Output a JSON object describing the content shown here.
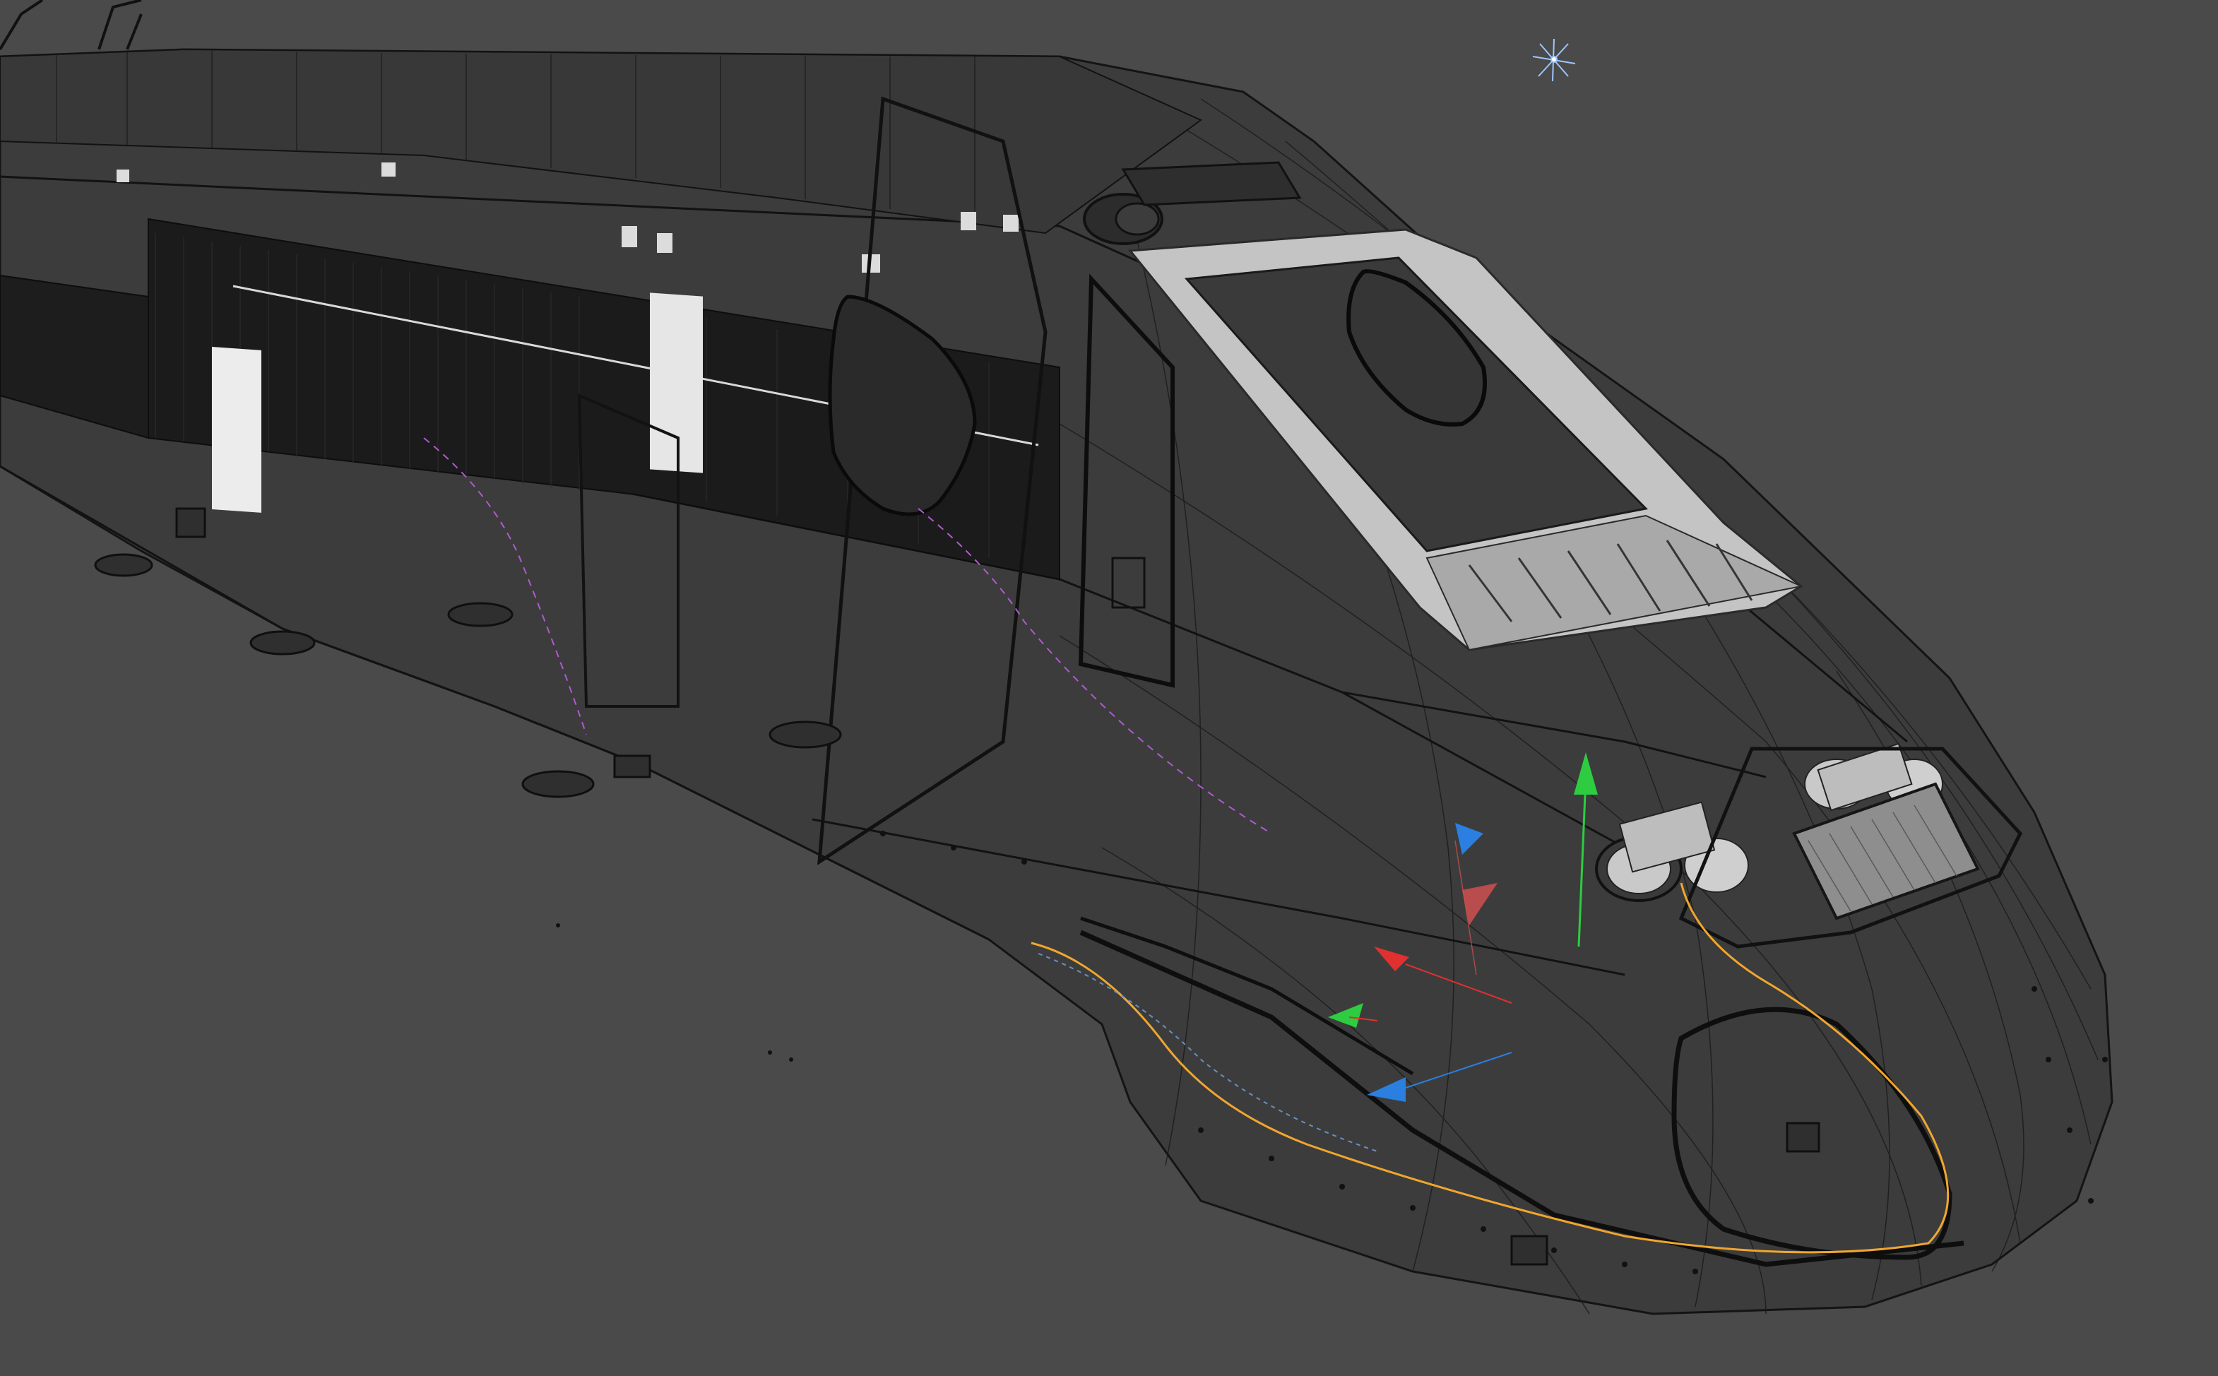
{
  "viewport": {
    "background_color": "#4a4a4a",
    "wire_color": "#141414",
    "hull_fill": "#3d3d3d",
    "window_frame_fill": "#c9c9c9",
    "spline_color": "#f0a62e",
    "guide_color": "#b05ad0"
  },
  "gizmo": {
    "y_axis_color": "#2ecc40",
    "x_axis_color": "#e03030",
    "z_axis_color": "#2a7fe0",
    "icon": "transform-gizmo-icon"
  },
  "light": {
    "icon": "omni-light-icon",
    "color": "#9ec7ff"
  },
  "object": {
    "icon": "train-head-wireframe"
  }
}
